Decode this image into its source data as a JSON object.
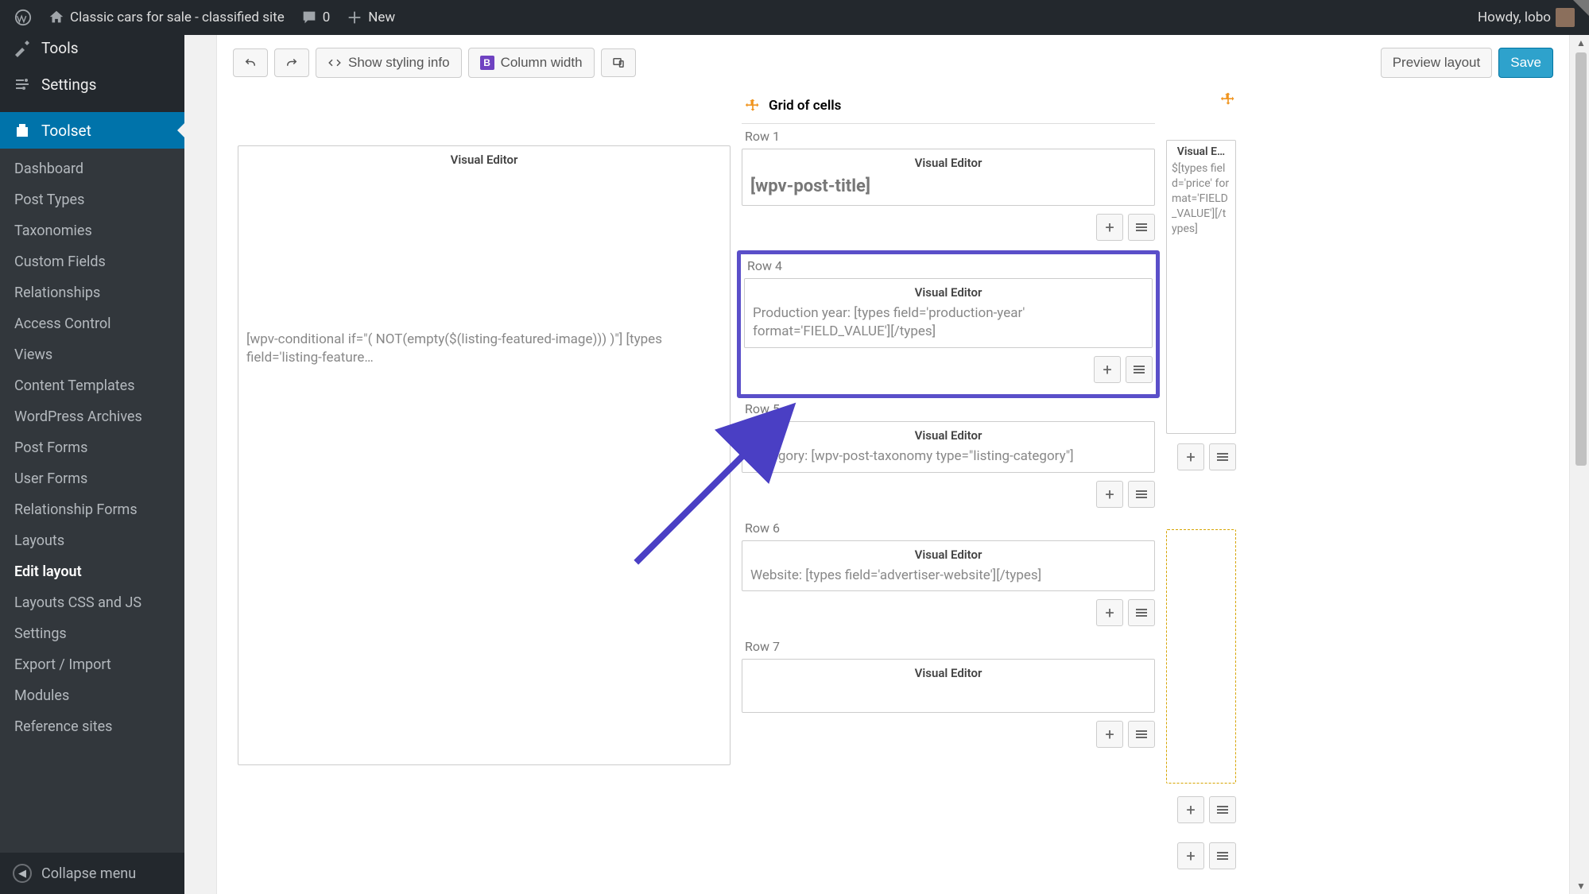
{
  "adminbar": {
    "site_title": "Classic cars for sale - classified site",
    "comments_count": "0",
    "new_label": "New",
    "howdy": "Howdy, lobo"
  },
  "sidebar": {
    "tools": "Tools",
    "settings": "Settings",
    "toolset": "Toolset",
    "items": [
      "Dashboard",
      "Post Types",
      "Taxonomies",
      "Custom Fields",
      "Relationships",
      "Access Control",
      "Views",
      "Content Templates",
      "WordPress Archives",
      "Post Forms",
      "User Forms",
      "Relationship Forms",
      "Layouts",
      "Edit layout",
      "Layouts CSS and JS",
      "Settings",
      "Export / Import",
      "Modules",
      "Reference sites"
    ],
    "collapse": "Collapse menu"
  },
  "toolbar": {
    "show_styling": "Show styling info",
    "column_width": "Column width",
    "preview": "Preview layout",
    "save": "Save"
  },
  "grid": {
    "header": "Grid of cells",
    "left": {
      "editor_label": "Visual Editor",
      "content": "[wpv-conditional if=\"( NOT(empty($(listing-featured-image))) )\"] [types field='listing-feature…"
    },
    "rows": [
      {
        "label": "Row 1",
        "editor": "Visual Editor",
        "content": "[wpv-post-title]",
        "title": true
      },
      {
        "label": "Row 4",
        "editor": "Visual Editor",
        "content": "Production year: [types field='production-year' format='FIELD_VALUE'][/types]",
        "highlight": true
      },
      {
        "label": "Row 5",
        "editor": "Visual Editor",
        "content": "Category: [wpv-post-taxonomy type=\"listing-category\"]"
      },
      {
        "label": "Row 6",
        "editor": "Visual Editor",
        "content": "Website: [types field='advertiser-website'][/types]"
      },
      {
        "label": "Row 7",
        "editor": "Visual Editor",
        "content": ""
      }
    ],
    "right": {
      "editor_label": "Visual E…",
      "content": "$[types field='price' format='FIELD_VALUE'][/types]"
    }
  }
}
